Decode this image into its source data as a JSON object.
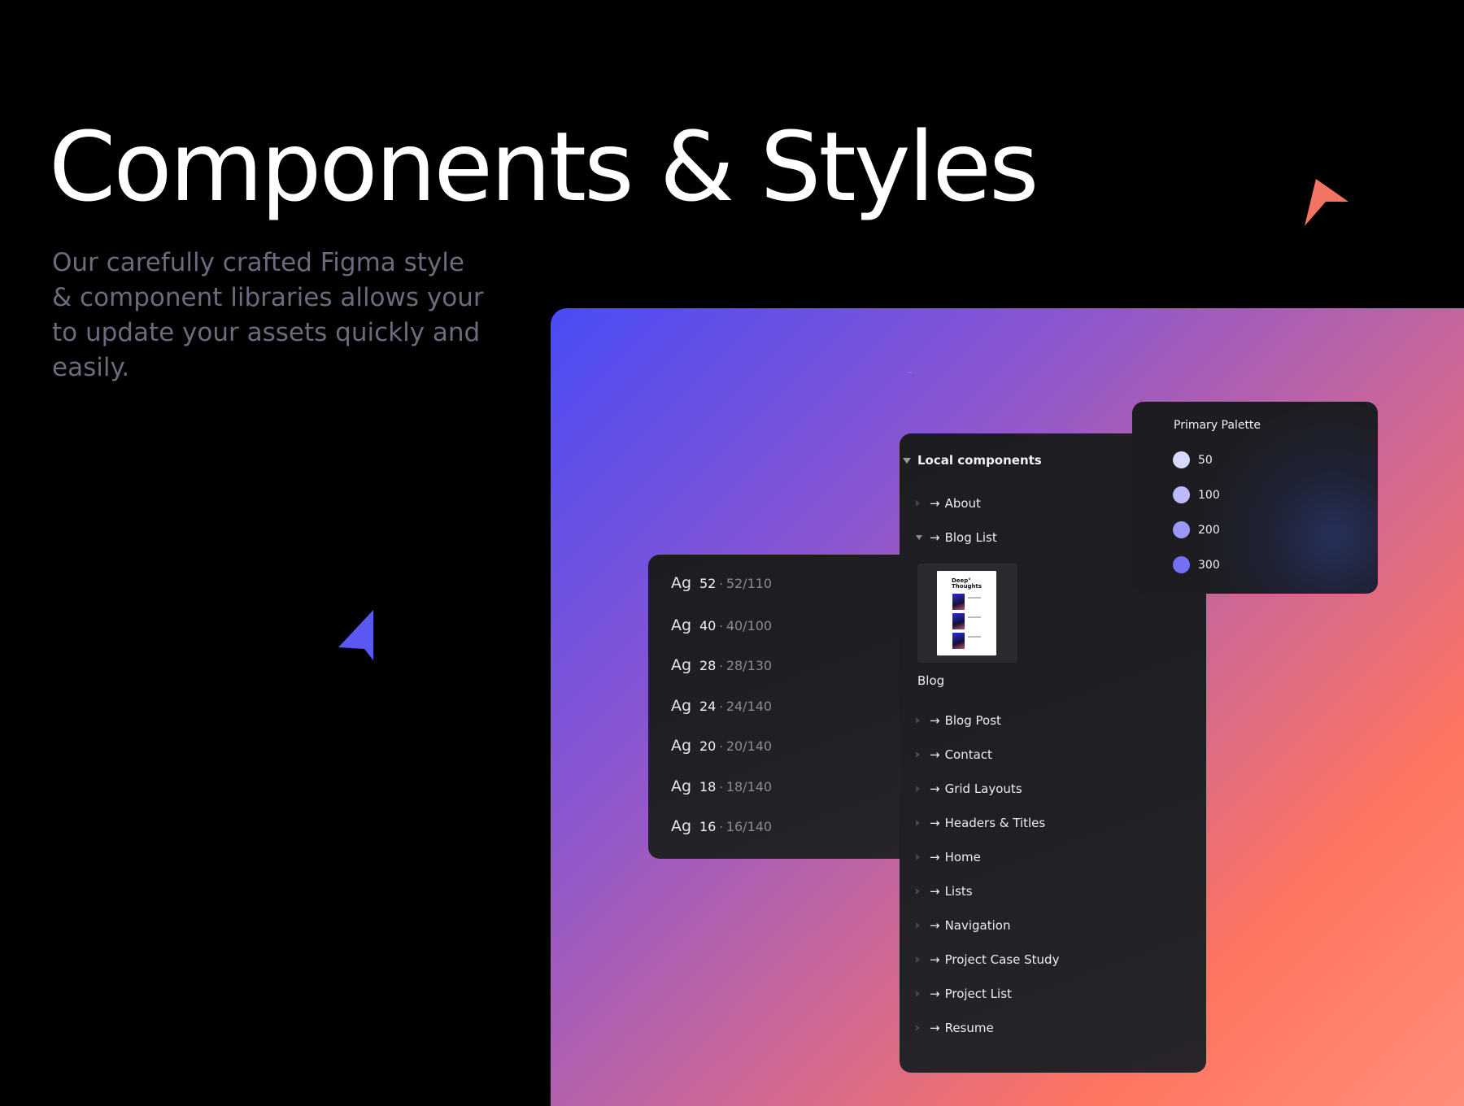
{
  "hero": {
    "title": "Components & Styles",
    "subtitle": "Our carefully crafted Figma style & component libraries allows your to update your assets quickly and easily."
  },
  "colors": {
    "cursor_coral": "#f27462",
    "cursor_blue": "#5b57f2"
  },
  "typography": {
    "rows": [
      {
        "ag": "Ag",
        "size": "52",
        "spec": "52/110"
      },
      {
        "ag": "Ag",
        "size": "40",
        "spec": "40/100"
      },
      {
        "ag": "Ag",
        "size": "28",
        "spec": "28/130"
      },
      {
        "ag": "Ag",
        "size": "24",
        "spec": "24/140"
      },
      {
        "ag": "Ag",
        "size": "20",
        "spec": "20/140"
      },
      {
        "ag": "Ag",
        "size": "18",
        "spec": "18/140"
      },
      {
        "ag": "Ag",
        "size": "16",
        "spec": "16/140"
      }
    ],
    "separator": "·"
  },
  "components": {
    "header": "Local components",
    "arrow": "→",
    "items": [
      {
        "label": "About"
      },
      {
        "label": "Blog List",
        "expanded": true
      },
      {
        "label": "Blog Post"
      },
      {
        "label": "Contact"
      },
      {
        "label": "Grid Layouts"
      },
      {
        "label": "Headers & Titles"
      },
      {
        "label": "Home"
      },
      {
        "label": "Lists"
      },
      {
        "label": "Navigation"
      },
      {
        "label": "Project Case Study"
      },
      {
        "label": "Project List"
      },
      {
        "label": "Resume"
      }
    ],
    "thumbnail": {
      "heading": "Deep° Thoughts",
      "label": "Blog"
    }
  },
  "palette": {
    "title": "Primary Palette",
    "swatches": [
      {
        "label": "50",
        "color": "#d9d8fd"
      },
      {
        "label": "100",
        "color": "#bcbafb"
      },
      {
        "label": "200",
        "color": "#9c98f8"
      },
      {
        "label": "300",
        "color": "#7470f5"
      }
    ]
  }
}
